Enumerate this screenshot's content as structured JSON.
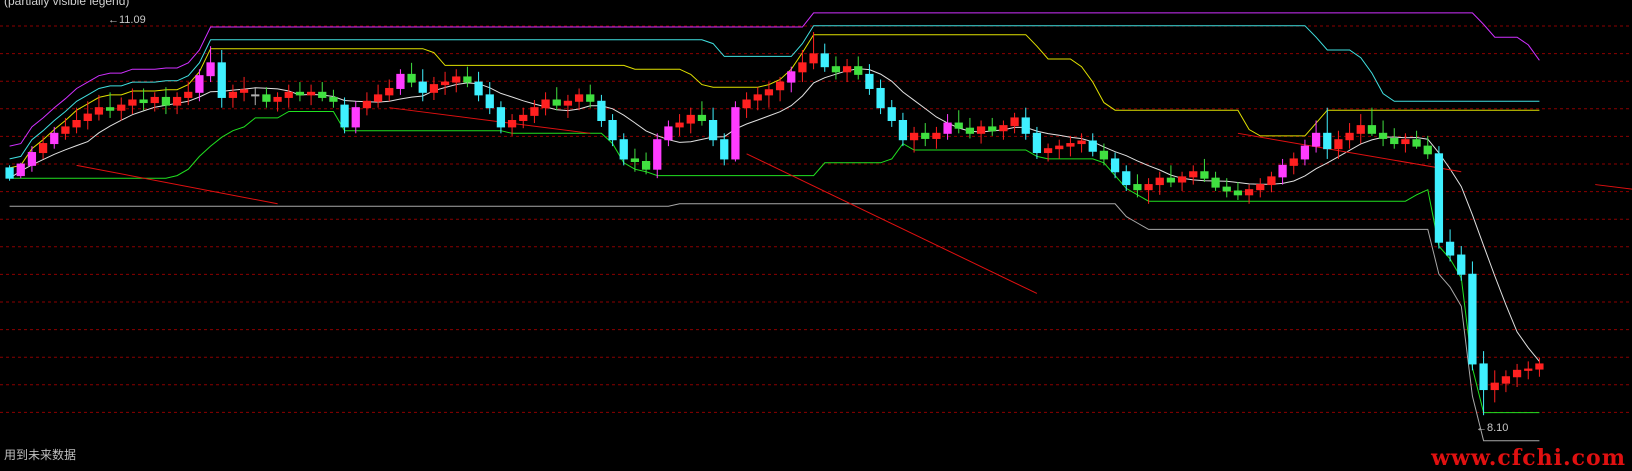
{
  "header": {
    "items": [
      {
        "text": "(partially visible legend)",
        "color": "#cfcfcf"
      }
    ]
  },
  "labels": {
    "high": "11.09",
    "low": "8.10",
    "note": "用到未来数据",
    "watermark": "www.cfchi.com"
  },
  "colors": {
    "background": "#000000",
    "grid": "#8b0000",
    "up": "#ff3cff",
    "down": "#3ff0ff",
    "flat": "#b0b0b0",
    "small_up": "#ff2020",
    "small_down": "#40e040",
    "magenta_line": "#d030ff",
    "cyan_line": "#40e0e0",
    "yellow_line": "#e0e000",
    "green_line": "#20e020",
    "white_line": "#e0e0e0",
    "gray_line": "#a8a8a8",
    "red_line": "#e01010"
  },
  "chart_data": {
    "type": "candlestick",
    "ylim": [
      8.0,
      11.2
    ],
    "grid": "horizontal dashed",
    "candles": [
      [
        10.03,
        10.05,
        9.93,
        9.95
      ],
      [
        9.97,
        10.07,
        9.95,
        10.06
      ],
      [
        10.05,
        10.2,
        10.0,
        10.15
      ],
      [
        10.15,
        10.27,
        10.1,
        10.22
      ],
      [
        10.22,
        10.35,
        10.18,
        10.3
      ],
      [
        10.3,
        10.42,
        10.25,
        10.35
      ],
      [
        10.35,
        10.5,
        10.3,
        10.4
      ],
      [
        10.4,
        10.55,
        10.33,
        10.45
      ],
      [
        10.45,
        10.6,
        10.4,
        10.5
      ],
      [
        10.5,
        10.62,
        10.42,
        10.48
      ],
      [
        10.48,
        10.58,
        10.4,
        10.52
      ],
      [
        10.52,
        10.65,
        10.45,
        10.56
      ],
      [
        10.56,
        10.65,
        10.48,
        10.54
      ],
      [
        10.54,
        10.62,
        10.47,
        10.58
      ],
      [
        10.58,
        10.66,
        10.45,
        10.52
      ],
      [
        10.52,
        10.62,
        10.45,
        10.58
      ],
      [
        10.58,
        10.7,
        10.52,
        10.62
      ],
      [
        10.62,
        10.8,
        10.55,
        10.75
      ],
      [
        10.75,
        10.98,
        10.7,
        10.85
      ],
      [
        10.85,
        10.95,
        10.5,
        10.58
      ],
      [
        10.58,
        10.68,
        10.5,
        10.62
      ],
      [
        10.62,
        10.74,
        10.55,
        10.64
      ],
      [
        10.6,
        10.66,
        10.52,
        10.6
      ],
      [
        10.6,
        10.66,
        10.5,
        10.55
      ],
      [
        10.55,
        10.62,
        10.47,
        10.58
      ],
      [
        10.58,
        10.68,
        10.5,
        10.62
      ],
      [
        10.62,
        10.7,
        10.55,
        10.6
      ],
      [
        10.6,
        10.68,
        10.52,
        10.62
      ],
      [
        10.62,
        10.7,
        10.55,
        10.58
      ],
      [
        10.58,
        10.64,
        10.5,
        10.55
      ],
      [
        10.52,
        10.58,
        10.3,
        10.35
      ],
      [
        10.35,
        10.55,
        10.3,
        10.5
      ],
      [
        10.5,
        10.62,
        10.44,
        10.55
      ],
      [
        10.55,
        10.68,
        10.5,
        10.6
      ],
      [
        10.6,
        10.72,
        10.55,
        10.65
      ],
      [
        10.65,
        10.8,
        10.6,
        10.76
      ],
      [
        10.76,
        10.85,
        10.66,
        10.7
      ],
      [
        10.7,
        10.8,
        10.55,
        10.62
      ],
      [
        10.62,
        10.74,
        10.56,
        10.68
      ],
      [
        10.68,
        10.78,
        10.6,
        10.7
      ],
      [
        10.7,
        10.8,
        10.62,
        10.74
      ],
      [
        10.74,
        10.82,
        10.66,
        10.7
      ],
      [
        10.7,
        10.78,
        10.55,
        10.6
      ],
      [
        10.6,
        10.7,
        10.45,
        10.5
      ],
      [
        10.5,
        10.55,
        10.3,
        10.35
      ],
      [
        10.35,
        10.45,
        10.28,
        10.4
      ],
      [
        10.4,
        10.5,
        10.34,
        10.44
      ],
      [
        10.44,
        10.56,
        10.38,
        10.5
      ],
      [
        10.5,
        10.62,
        10.44,
        10.56
      ],
      [
        10.56,
        10.66,
        10.48,
        10.52
      ],
      [
        10.52,
        10.6,
        10.42,
        10.55
      ],
      [
        10.55,
        10.65,
        10.48,
        10.6
      ],
      [
        10.6,
        10.68,
        10.5,
        10.55
      ],
      [
        10.55,
        10.6,
        10.35,
        10.4
      ],
      [
        10.4,
        10.45,
        10.2,
        10.25
      ],
      [
        10.25,
        10.3,
        10.05,
        10.1
      ],
      [
        10.1,
        10.18,
        10.0,
        10.08
      ],
      [
        10.08,
        10.15,
        9.98,
        10.02
      ],
      [
        10.02,
        10.3,
        9.95,
        10.25
      ],
      [
        10.25,
        10.4,
        10.2,
        10.35
      ],
      [
        10.35,
        10.45,
        10.28,
        10.38
      ],
      [
        10.38,
        10.5,
        10.3,
        10.44
      ],
      [
        10.44,
        10.55,
        10.36,
        10.4
      ],
      [
        10.4,
        10.5,
        10.2,
        10.25
      ],
      [
        10.25,
        10.3,
        10.05,
        10.1
      ],
      [
        10.1,
        10.55,
        10.08,
        10.5
      ],
      [
        10.5,
        10.62,
        10.42,
        10.56
      ],
      [
        10.56,
        10.66,
        10.48,
        10.6
      ],
      [
        10.6,
        10.7,
        10.5,
        10.64
      ],
      [
        10.64,
        10.74,
        10.55,
        10.7
      ],
      [
        10.7,
        10.82,
        10.62,
        10.78
      ],
      [
        10.78,
        10.95,
        10.7,
        10.85
      ],
      [
        10.85,
        11.09,
        10.8,
        10.92
      ],
      [
        10.92,
        11.0,
        10.78,
        10.82
      ],
      [
        10.82,
        10.9,
        10.72,
        10.78
      ],
      [
        10.78,
        10.88,
        10.7,
        10.82
      ],
      [
        10.82,
        10.9,
        10.72,
        10.76
      ],
      [
        10.76,
        10.84,
        10.6,
        10.65
      ],
      [
        10.65,
        10.72,
        10.45,
        10.5
      ],
      [
        10.5,
        10.56,
        10.35,
        10.4
      ],
      [
        10.4,
        10.46,
        10.2,
        10.25
      ],
      [
        10.25,
        10.35,
        10.15,
        10.3
      ],
      [
        10.3,
        10.38,
        10.2,
        10.26
      ],
      [
        10.26,
        10.35,
        10.18,
        10.3
      ],
      [
        10.3,
        10.45,
        10.25,
        10.38
      ],
      [
        10.38,
        10.48,
        10.3,
        10.34
      ],
      [
        10.34,
        10.42,
        10.26,
        10.3
      ],
      [
        10.3,
        10.4,
        10.22,
        10.35
      ],
      [
        10.35,
        10.42,
        10.28,
        10.32
      ],
      [
        10.32,
        10.4,
        10.25,
        10.36
      ],
      [
        10.36,
        10.46,
        10.3,
        10.42
      ],
      [
        10.42,
        10.5,
        10.25,
        10.3
      ],
      [
        10.3,
        10.35,
        10.1,
        10.15
      ],
      [
        10.15,
        10.22,
        10.08,
        10.18
      ],
      [
        10.18,
        10.25,
        10.1,
        10.2
      ],
      [
        10.2,
        10.28,
        10.12,
        10.22
      ],
      [
        10.22,
        10.3,
        10.15,
        10.24
      ],
      [
        10.24,
        10.3,
        10.12,
        10.16
      ],
      [
        10.16,
        10.22,
        10.05,
        10.1
      ],
      [
        10.1,
        10.15,
        9.95,
        10.0
      ],
      [
        10.0,
        10.05,
        9.85,
        9.9
      ],
      [
        9.9,
        9.98,
        9.8,
        9.86
      ],
      [
        9.86,
        9.95,
        9.75,
        9.9
      ],
      [
        9.9,
        10.0,
        9.82,
        9.95
      ],
      [
        9.95,
        10.05,
        9.88,
        9.92
      ],
      [
        9.92,
        10.0,
        9.85,
        9.96
      ],
      [
        9.96,
        10.05,
        9.9,
        10.0
      ],
      [
        10.0,
        10.1,
        9.92,
        9.95
      ],
      [
        9.95,
        10.0,
        9.85,
        9.88
      ],
      [
        9.88,
        9.95,
        9.8,
        9.85
      ],
      [
        9.85,
        9.92,
        9.78,
        9.82
      ],
      [
        9.82,
        9.9,
        9.75,
        9.86
      ],
      [
        9.86,
        9.95,
        9.8,
        9.9
      ],
      [
        9.9,
        10.0,
        9.84,
        9.96
      ],
      [
        9.96,
        10.1,
        9.9,
        10.05
      ],
      [
        10.05,
        10.15,
        9.98,
        10.1
      ],
      [
        10.1,
        10.25,
        10.05,
        10.2
      ],
      [
        10.2,
        10.4,
        10.15,
        10.3
      ],
      [
        10.3,
        10.5,
        10.1,
        10.18
      ],
      [
        10.18,
        10.32,
        10.1,
        10.25
      ],
      [
        10.25,
        10.38,
        10.18,
        10.3
      ],
      [
        10.3,
        10.45,
        10.22,
        10.36
      ],
      [
        10.36,
        10.5,
        10.28,
        10.3
      ],
      [
        10.3,
        10.4,
        10.2,
        10.26
      ],
      [
        10.26,
        10.34,
        10.18,
        10.22
      ],
      [
        10.22,
        10.3,
        10.15,
        10.25
      ],
      [
        10.25,
        10.32,
        10.18,
        10.2
      ],
      [
        10.2,
        10.28,
        10.1,
        10.14
      ],
      [
        10.14,
        10.2,
        9.4,
        9.45
      ],
      [
        9.45,
        9.55,
        9.3,
        9.35
      ],
      [
        9.35,
        9.42,
        9.15,
        9.2
      ],
      [
        9.2,
        9.3,
        8.45,
        8.5
      ],
      [
        8.5,
        8.6,
        8.1,
        8.3
      ],
      [
        8.3,
        8.45,
        8.2,
        8.35
      ],
      [
        8.35,
        8.45,
        8.28,
        8.4
      ],
      [
        8.4,
        8.5,
        8.32,
        8.45
      ],
      [
        8.45,
        8.52,
        8.38,
        8.46
      ],
      [
        8.46,
        8.55,
        8.4,
        8.5
      ]
    ]
  }
}
